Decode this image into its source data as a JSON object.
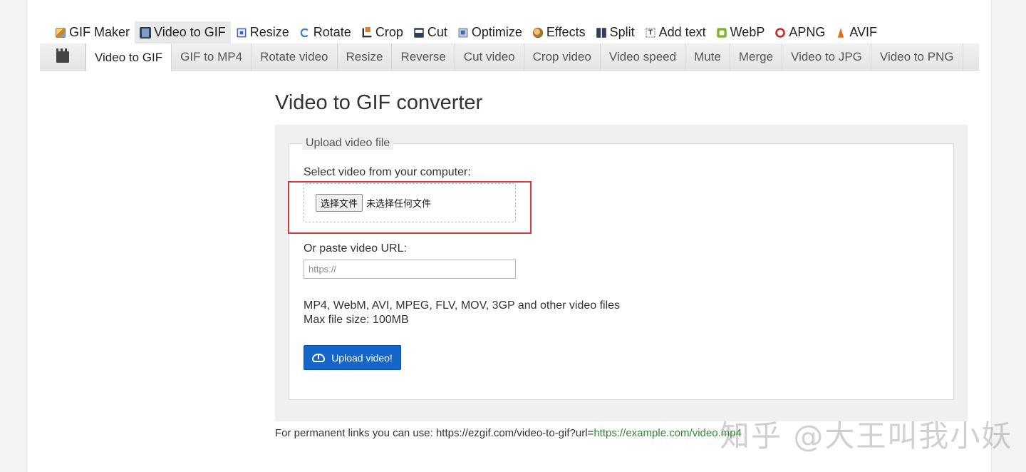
{
  "topnav": {
    "items": [
      {
        "label": "GIF Maker",
        "icon": "gif-maker-icon"
      },
      {
        "label": "Video to GIF",
        "icon": "film-icon"
      },
      {
        "label": "Resize",
        "icon": "resize-icon"
      },
      {
        "label": "Rotate",
        "icon": "rotate-icon"
      },
      {
        "label": "Crop",
        "icon": "crop-icon"
      },
      {
        "label": "Cut",
        "icon": "cut-icon"
      },
      {
        "label": "Optimize",
        "icon": "optimize-icon"
      },
      {
        "label": "Effects",
        "icon": "effects-icon"
      },
      {
        "label": "Split",
        "icon": "split-icon"
      },
      {
        "label": "Add text",
        "icon": "add-text-icon"
      },
      {
        "label": "WebP",
        "icon": "webp-icon"
      },
      {
        "label": "APNG",
        "icon": "apng-icon"
      },
      {
        "label": "AVIF",
        "icon": "avif-icon"
      }
    ],
    "active": "Video to GIF"
  },
  "subnav": {
    "icon": "clapperboard-icon",
    "items": [
      "Video to GIF",
      "GIF to MP4",
      "Rotate video",
      "Resize",
      "Reverse",
      "Cut video",
      "Crop video",
      "Video speed",
      "Mute",
      "Merge",
      "Video to JPG",
      "Video to PNG"
    ],
    "active": "Video to GIF"
  },
  "main": {
    "title": "Video to GIF converter",
    "legend": "Upload video file",
    "select_label": "Select video from your computer:",
    "file_button": "选择文件",
    "file_status": "未选择任何文件",
    "url_label": "Or paste video URL:",
    "url_placeholder": "https://",
    "formats": "MP4, WebM, AVI, MPEG, FLV, MOV, 3GP and other video files",
    "max_size": "Max file size: 100MB",
    "upload_button": "Upload video!"
  },
  "footer": {
    "permalink_prefix": "For permanent links you can use: https://ezgif.com/video-to-gif?url=",
    "permalink_example": "https://example.com/video.mp4"
  },
  "watermark": "知乎 @大王叫我小妖",
  "colors": {
    "accent": "#1467c8",
    "highlight_box": "#d9383e",
    "link_green": "#2e8b2e"
  }
}
